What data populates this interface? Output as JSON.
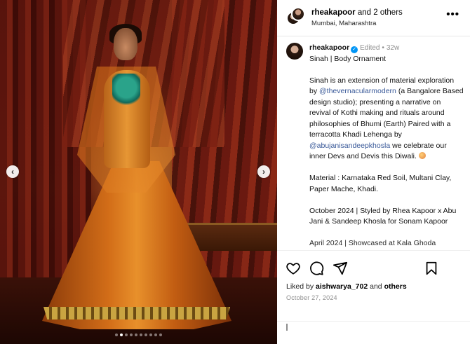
{
  "post": {
    "header": {
      "username": "rheakapoor",
      "collab_text": "and 2 others",
      "location": "Mumbai, Maharashtra",
      "more_label": "•••"
    },
    "caption": {
      "username": "rheakapoor",
      "verified_mark": "✓",
      "edited": "Edited",
      "separator": "•",
      "age": "32w",
      "title": "Sinah | Body Ornament",
      "p1_a": "Sinah is an extension of material exploration by ",
      "p1_mention": "@thevernacularmodern",
      "p1_b": " (a Bangalore Based design studio); presenting a narrative on revival of Kothi making and rituals around philosophies of Bhumi (Earth) Paired with a terracotta Khadi Lehenga by ",
      "p1_mention2": "@abujanisandeepkhosla",
      "p1_c": " we celebrate our inner Devs and Devis this Diwali. ",
      "p2": "Material : Karnataka Red Soil, Multani Clay, Paper Mache, Khadi.",
      "p3": "October 2024 | Styled by Rhea Kapoor x Abu Jani & Sandeep Khosla for Sonam Kapoor",
      "p4_partial": "April 2024 | Showcased at Kala Ghoda"
    },
    "likes": {
      "prefix": "Liked by",
      "user": "aishwarya_702",
      "and": "and",
      "others": "others"
    },
    "date": "October 27, 2024",
    "carousel": {
      "prev_label": "‹",
      "next_label": "›",
      "total": 10,
      "active_index": 1
    }
  }
}
